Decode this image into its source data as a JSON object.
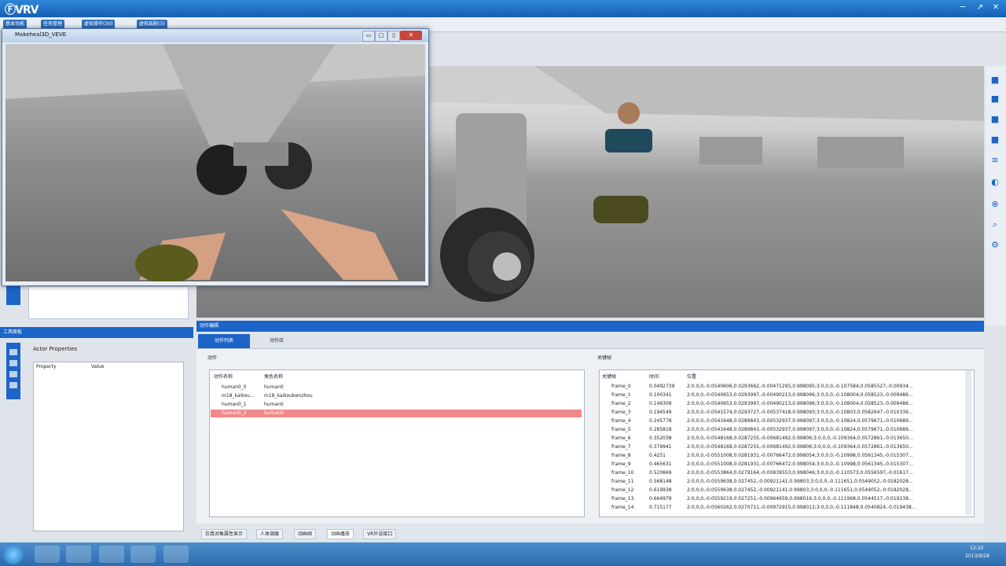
{
  "window": {
    "logo": "ⒻVRV",
    "controls": [
      "─",
      "↗",
      "✕"
    ]
  },
  "menu_tabs": [
    "基本功能",
    "任务管理",
    "虚拟操作(3d)",
    "虚拟装配(3)"
  ],
  "video_window": {
    "title": "Makeheal3D_VEVE",
    "controls": [
      "▭",
      "□",
      "▯"
    ],
    "close": "✕"
  },
  "left_panel": {
    "tools_header": "工具面板",
    "actor_properties_label": "Actor Properties",
    "property_header": "Property",
    "value_header": "Value"
  },
  "data_panel": {
    "header": "动作编辑",
    "tabs": [
      "动作列表",
      "动作库"
    ],
    "actions_label": "动作",
    "actions_columns": [
      "动作名称",
      "角色名称"
    ],
    "actions_rows": [
      [
        "human0_0",
        "human0"
      ],
      [
        "m18_kaikou...",
        "m18_kaikoubenzhou"
      ],
      [
        "human0_1",
        "human0"
      ],
      [
        "human0_2",
        "human0"
      ]
    ],
    "keyframe_label": "关键帧",
    "keyframe_columns": [
      "关键帧",
      "时间",
      "位置"
    ],
    "keyframe_rows": [
      [
        "frame_0",
        "0.0492739",
        "2:0.0,0,-0.0540606,0.0293662,-0.00471295,0.998095;3:0,0,0,-0.107584,0.0585527,-0.00934..."
      ],
      [
        "frame_1",
        "0.100341",
        "2:0,0,0,-0.0540653,0.0293997,-0.00490213,0.998096;3:0,0,0,-0.108004,0.058523,-0.009486..."
      ],
      [
        "frame_2",
        "0.146309",
        "2:0,0,0,-0.0540653,0.0293997,-0.00490213,0.998096;3:0,0,0,-0.108004,0.058523,-0.009486..."
      ],
      [
        "frame_3",
        "0.194549",
        "2:0,0,0,-0.0541574,0.0293727,-0.00537418,0.998093;3:0,0,0,-0.10803,0.0582647,-0.010336..."
      ],
      [
        "frame_4",
        "0.245778",
        "2:0,0,0,-0.0541648,0.0289843,-0.00532937,0.998097;3:0,0,0,-0.10824,0.0579671,-0.010689..."
      ],
      [
        "frame_5",
        "0.285818",
        "2:0,0,0,-0.0541648,0.0289843,-0.00532937,0.998097;3:0,0,0,-0.10824,0.0579671,-0.010689..."
      ],
      [
        "frame_6",
        "0.352038",
        "2:0,0,0,-0.0548168,0.0287255,-0.00681492,0.99806;3:0,0,0,-0.109364,0.0572861,-0.013650..."
      ],
      [
        "frame_7",
        "0.379941",
        "2:0,0,0,-0.0548168,0.0287255,-0.00681492,0.99806;3:0,0,0,-0.109364,0.0572861,-0.013650..."
      ],
      [
        "frame_8",
        "0.4251",
        "2:0,0,0,-0.0551008,0.0281931,-0.00766472,0.998054;3:0,0,0,-0.10998,0.0561345,-0.015307..."
      ],
      [
        "frame_9",
        "0.465631",
        "2:0,0,0,-0.0551008,0.0281931,-0.00766472,0.998054;3:0,0,0,-0.10998,0.0561345,-0.015307..."
      ],
      [
        "frame_10",
        "0.520669",
        "2:0,0,0,-0.0553864,0.0279164,-0.00839553,0.998046;3:0,0,0,-0.110573,0.0556597,-0.01617..."
      ],
      [
        "frame_11",
        "0.568148",
        "2:0,0,0,-0.0559638,0.027452,-0.00921141,0.99803;3:0,0,0,-0.111651,0.0549052,-0.0182028..."
      ],
      [
        "frame_12",
        "0.619938",
        "2:0,0,0,-0.0559638,0.027452,-0.00921141,0.99803;3:0,0,0,-0.111651,0.0549052,-0.0182028..."
      ],
      [
        "frame_13",
        "0.664979",
        "2:0,0,0,-0.0559219,0.027251,-0.00964659,0.998016;3:0,0,0,-0.111968,0.0544517,-0.019238..."
      ],
      [
        "frame_14",
        "0.715177",
        "2:0,0,0,-0.0560262,0.0270711,-0.00972915,0.998013;3:0,0,0,-0.111848,0.0540824,-0.019438..."
      ]
    ]
  },
  "bottom_tabs": [
    "仿真对象属性显示",
    "人体调器",
    "动画帧",
    "动画播放",
    "VR外设接口"
  ],
  "taskbar": {
    "time": "12:20",
    "date": "2013/9/28"
  },
  "colors": {
    "accent": "#1c64c8",
    "selected_row": "#f08a8a"
  }
}
